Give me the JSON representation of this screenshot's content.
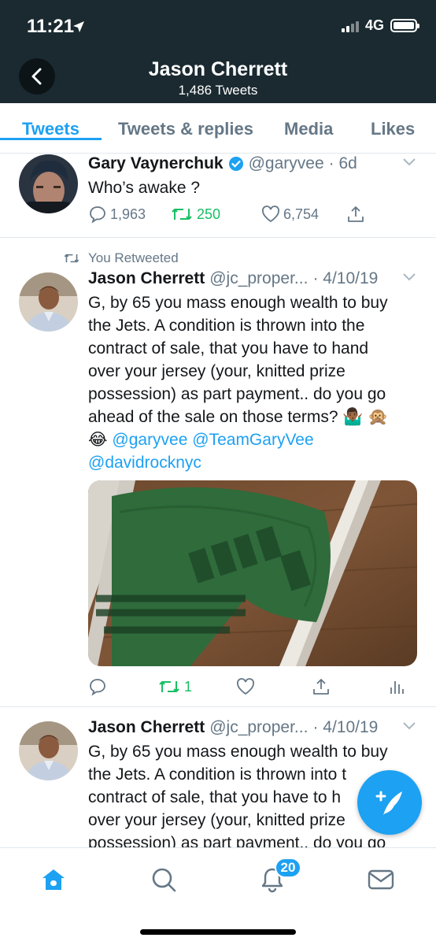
{
  "status_bar": {
    "time": "11:21",
    "network": "4G",
    "battery_level": 1.0
  },
  "header": {
    "title": "Jason Cherrett",
    "subtitle": "1,486 Tweets"
  },
  "tabs": [
    {
      "label": "Tweets",
      "active": true
    },
    {
      "label": "Tweets & replies",
      "active": false
    },
    {
      "label": "Media",
      "active": false
    },
    {
      "label": "Likes",
      "active": false
    }
  ],
  "tweets": [
    {
      "name": "Gary Vaynerchuk",
      "handle": "@garyvee",
      "time": "· 6d",
      "verified": true,
      "lines": [
        "Who’s awake ?"
      ],
      "replies": "1,963",
      "retweets": "250",
      "likes": "6,754"
    },
    {
      "retweet_label": "You Retweeted",
      "name": "Jason Cherrett",
      "handle": "@jc_proper...",
      "time": "· 4/10/19",
      "lines": [
        "G, by 65 you mass enough wealth to buy",
        "the Jets. A condition is thrown into the",
        "contract of sale, that you have to hand",
        "over your jersey (your, knitted prize",
        "possession) as part payment.. do you go",
        "ahead of the sale on those terms? 🤷🏾‍♂️ 🙊"
      ],
      "emoji_line": "😂",
      "mention_1": "@garyvee",
      "mention_2": "@TeamGaryVee",
      "mention_3": "@davidrocknyc",
      "retweets": "1"
    },
    {
      "name": "Jason Cherrett",
      "handle": "@jc_proper...",
      "time": "· 4/10/19",
      "lines": [
        "G, by 65 you mass enough wealth to buy",
        "the Jets. A condition is thrown into t",
        "contract of sale, that you have to h",
        "over your jersey (your, knitted prize",
        "possession) as part payment.. do you go"
      ]
    }
  ],
  "notifications_badge": "20",
  "colors": {
    "accent": "#1da1f2",
    "header_bg": "#1b2a31",
    "retweet_green": "#17bf63",
    "muted": "#657786"
  },
  "icons": [
    "back-arrow-icon",
    "verified-icon",
    "chevron-down-icon",
    "reply-icon",
    "retweet-icon",
    "like-icon",
    "share-icon",
    "analytics-icon",
    "compose-icon",
    "home-icon",
    "search-icon",
    "bell-icon",
    "mail-icon"
  ]
}
